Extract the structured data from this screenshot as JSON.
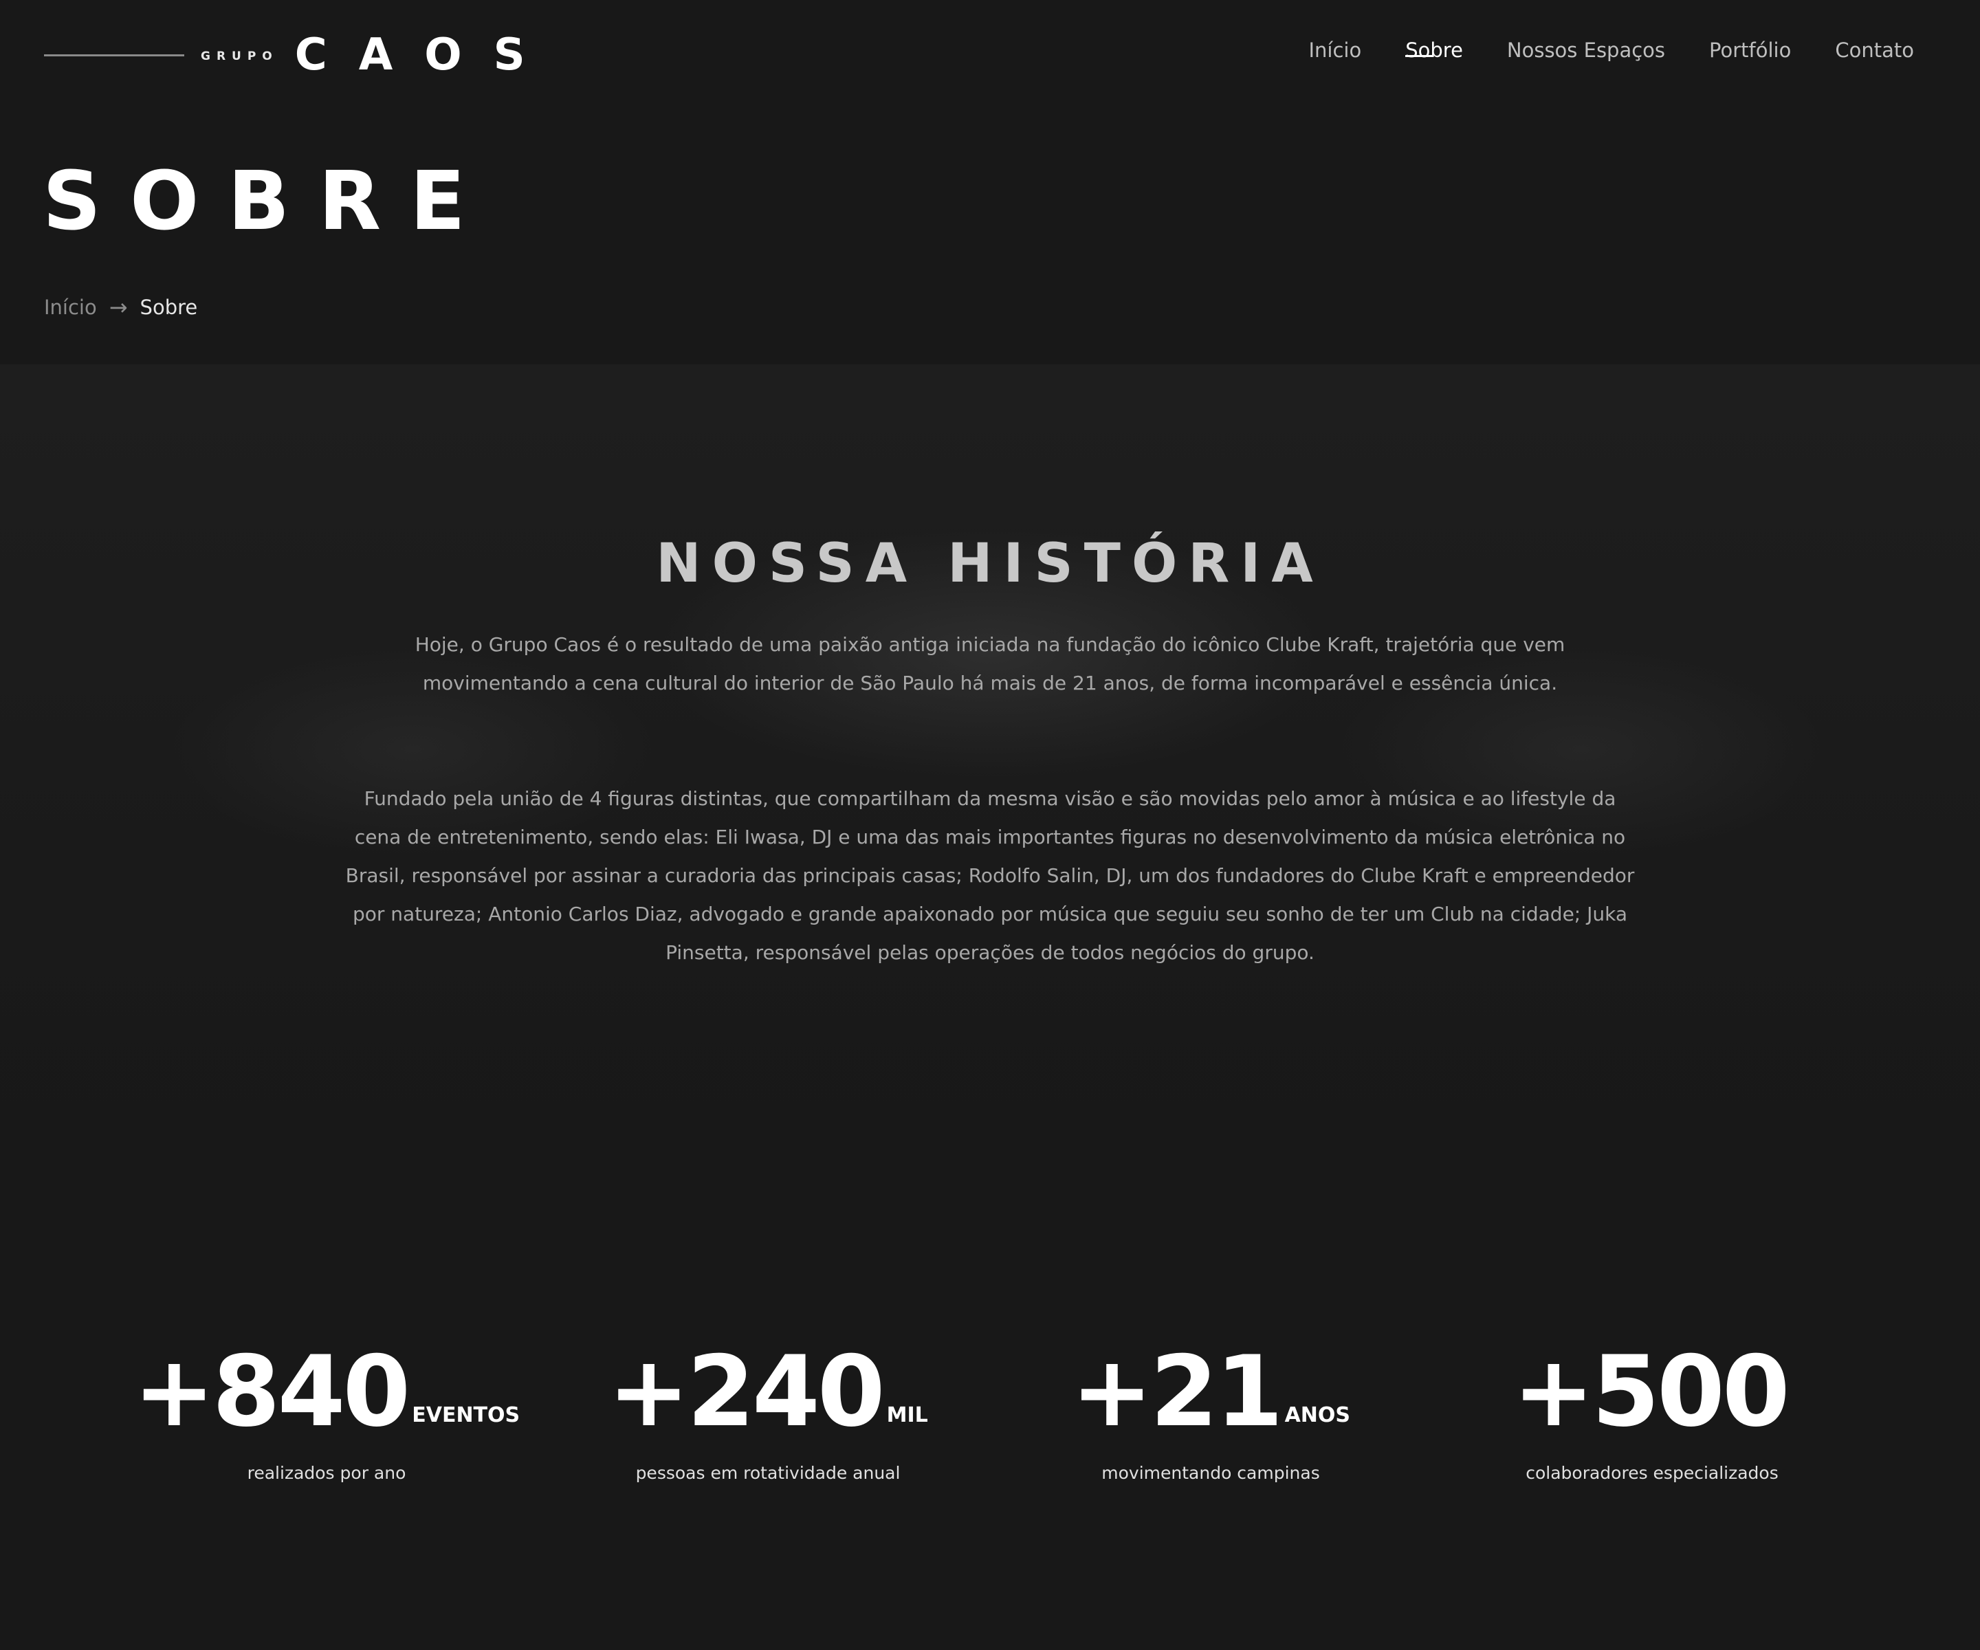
{
  "header": {
    "logo": {
      "small": "GRUPO",
      "large": "CAOS"
    },
    "nav": [
      {
        "label": "Início",
        "active": false
      },
      {
        "label": "Sobre",
        "active": true
      },
      {
        "label": "Nossos Espaços",
        "active": false
      },
      {
        "label": "Portfólio",
        "active": false
      },
      {
        "label": "Contato",
        "active": false
      }
    ]
  },
  "page_title": "SOBRE",
  "breadcrumb": {
    "home": "Início",
    "current": "Sobre"
  },
  "history": {
    "title": "NOSSA HISTÓRIA",
    "paragraphs": [
      "Hoje, o Grupo Caos é o resultado de uma paixão antiga iniciada na fundação do icônico Clube Kraft, trajetória que vem movimentando a cena cultural do interior de São Paulo há mais de 21 anos, de forma incomparável e essência única.",
      "Fundado pela união de 4 figuras distintas, que compartilham da mesma visão e são movidas pelo amor à música e ao lifestyle da cena de entretenimento, sendo elas: Eli Iwasa, DJ e uma das mais importantes figuras no desenvolvimento da música eletrônica no Brasil, responsável por assinar a curadoria das principais casas; Rodolfo Salin, DJ, um dos fundadores do Clube Kraft e empreendedor por natureza; Antonio Carlos Diaz, advogado e grande apaixonado por música que seguiu seu sonho de ter um Club na cidade; Juka Pinsetta, responsável pelas operações de todos negócios do grupo."
    ]
  },
  "stats": [
    {
      "value": "+840",
      "unit": "EVENTOS",
      "caption": "realizados por ano"
    },
    {
      "value": "+240",
      "unit": "MIL",
      "caption": "pessoas em rotatividade anual"
    },
    {
      "value": "+21",
      "unit": "ANOS",
      "caption": "movimentando campinas"
    },
    {
      "value": "+500",
      "unit": "",
      "caption": "colaboradores especializados"
    }
  ],
  "colors": {
    "background": "#181818",
    "text_primary": "#ffffff",
    "text_muted": "#a8a8a8"
  }
}
